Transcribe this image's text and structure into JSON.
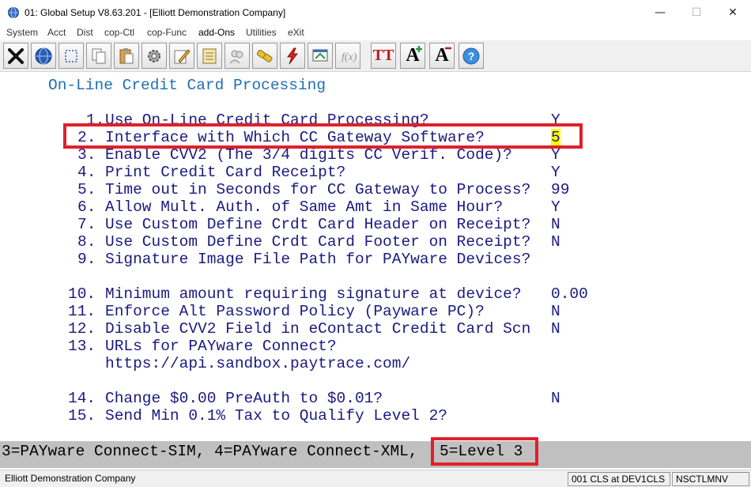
{
  "window": {
    "title": "01: Global Setup V8.63.201 - [Elliott Demonstration Company]",
    "minimize": "—",
    "maximize": "☐",
    "close": "✕"
  },
  "menu": [
    "System",
    "Acct",
    "Dist",
    "cop-Ctl",
    "cop-Func",
    "add-Ons",
    "Utilities",
    "eXit"
  ],
  "toolbar": {
    "icons": [
      "close-x-icon",
      "globe-icon",
      "select-icon",
      "copy-icon",
      "paste-icon",
      "gear-icon",
      "edit-icon",
      "notes-icon",
      "people-icon",
      "link-icon",
      "lightning-icon",
      "screen-icon",
      "function-icon",
      "font-tt-icon",
      "font-increase-icon",
      "font-decrease-icon",
      "help-icon"
    ],
    "font_tt": "TT",
    "font_up": "A",
    "font_down": "A",
    "help": "?"
  },
  "screen": {
    "heading": "On-Line Credit Card Processing",
    "items": [
      {
        "num": "1.",
        "label": "Use On-Line Credit Card Processing?",
        "value": "Y"
      },
      {
        "num": "2.",
        "label": "Interface with Which CC Gateway Software?",
        "value": "5"
      },
      {
        "num": "3.",
        "label": "Enable CVV2 (The 3/4 digits CC Verif. Code)?",
        "value": "Y"
      },
      {
        "num": "4.",
        "label": "Print Credit Card Receipt?",
        "value": "Y"
      },
      {
        "num": "5.",
        "label": "Time out in Seconds for CC Gateway to Process?",
        "value": "99"
      },
      {
        "num": "6.",
        "label": "Allow Mult. Auth. of Same Amt in Same Hour?",
        "value": "Y"
      },
      {
        "num": "7.",
        "label": "Use Custom Define Crdt Card Header on Receipt?",
        "value": "N"
      },
      {
        "num": "8.",
        "label": "Use Custom Define Crdt Card Footer on Receipt?",
        "value": "N"
      },
      {
        "num": "9.",
        "label": "Signature Image File Path for PAYware Devices?",
        "value": ""
      },
      {
        "num": "10.",
        "label": "Minimum amount requiring signature at device?",
        "value": "0.00"
      },
      {
        "num": "11.",
        "label": "Enforce Alt Password Policy (Payware PC)?",
        "value": "N"
      },
      {
        "num": "12.",
        "label": "Disable CVV2 Field in eContact Credit Card Scn",
        "value": "N"
      },
      {
        "num": "13.",
        "label": "URLs for PAYware Connect?",
        "value": ""
      },
      {
        "num": "14.",
        "label": "Change $0.00 PreAuth to $0.01?",
        "value": "N"
      },
      {
        "num": "15.",
        "label": "Send Min 0.1% Tax to Qualify Level 2?",
        "value": ""
      }
    ],
    "url": "https://api.sandbox.paytrace.com/"
  },
  "helpline": {
    "options": "3=PAYware Connect-SIM, 4=PAYware Connect-XML, ",
    "highlighted": "5=Level 3"
  },
  "status": {
    "company": "Elliott Demonstration Company",
    "station": "001 CLS at DEV1CLS",
    "program": "NSCTLMNV"
  },
  "colors": {
    "highlight_box": "#e0202a",
    "terminal_text": "#1a1a80",
    "heading_text": "#1f6fb2",
    "cursor_bg": "#ffff00",
    "helpline_bg": "#c0c0c0"
  }
}
